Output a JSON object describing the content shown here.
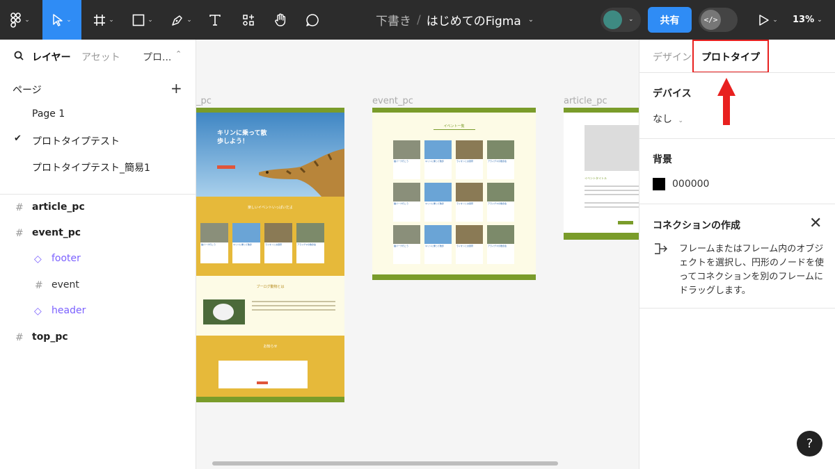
{
  "toolbar": {
    "file_draft": "下書き",
    "file_separator": "/",
    "file_name": "はじめてのFigma",
    "share_label": "共有",
    "devmode_glyph": "</>",
    "zoom": "13%",
    "icons": [
      "figma-menu-icon",
      "move-tool-icon",
      "frame-tool-icon",
      "shape-tool-icon",
      "pen-tool-icon",
      "text-tool-icon",
      "resources-icon",
      "hand-tool-icon",
      "comment-tool-icon",
      "present-icon"
    ]
  },
  "left_panel": {
    "tabs": {
      "layers": "レイヤー",
      "assets": "アセット",
      "page_menu": "プロ..."
    },
    "pages_header": "ページ",
    "add_glyph": "+",
    "pages": [
      {
        "label": "Page 1",
        "current": false
      },
      {
        "label": "プロトタイプテスト",
        "current": true
      },
      {
        "label": "プロトタイプテスト_簡易1",
        "current": false
      }
    ],
    "layers": [
      {
        "label": "article_pc",
        "kind": "frame"
      },
      {
        "label": "event_pc",
        "kind": "frame"
      },
      {
        "label": "footer",
        "kind": "component"
      },
      {
        "label": "event",
        "kind": "frame-child"
      },
      {
        "label": "header",
        "kind": "component"
      },
      {
        "label": "top_pc",
        "kind": "frame"
      }
    ]
  },
  "canvas": {
    "frames": [
      {
        "label": "_pc"
      },
      {
        "label": "event_pc"
      },
      {
        "label": "article_pc"
      }
    ],
    "top_pc": {
      "hero_text": "キリンに乗って散歩しよう！",
      "section1_title": "楽しいイベントいっぱいだよ",
      "card_titles": [
        "猫パーク行こう",
        "キリンに乗って散歩",
        "ライオンとお昼寝",
        "アライグマの散歩会"
      ],
      "section2_title": "ブーログ動物とは",
      "section3_title": "お知らせ"
    },
    "event_pc": {
      "title": "イベント一覧",
      "card_titles": [
        "猫パーク行こう",
        "キリンに乗って散歩",
        "ライオンとお昼寝",
        "アライグマの散歩会"
      ]
    },
    "article_pc": {
      "title": "イベントタイトル"
    }
  },
  "right_panel": {
    "tabs": {
      "design": "デザイン",
      "prototype": "プロトタイプ"
    },
    "device_heading": "デバイス",
    "device_value": "なし",
    "background_heading": "背景",
    "background_hex": "000000",
    "background_color": "#000000",
    "connection_heading": "コネクションの作成",
    "close_glyph": "✕",
    "connection_help": "フレームまたはフレーム内のオブジェクトを選択し、円形のノードを使ってコネクションを別のフレームにドラッグします。",
    "help_glyph": "?"
  },
  "colors": {
    "toolbar_bg": "#2c2c2c",
    "accent_blue": "#2f8cf5",
    "highlight_red": "#e8201f",
    "component_purple": "#7b61ff",
    "site_green": "#7a9c2a",
    "site_yellow": "#e6b93a"
  }
}
